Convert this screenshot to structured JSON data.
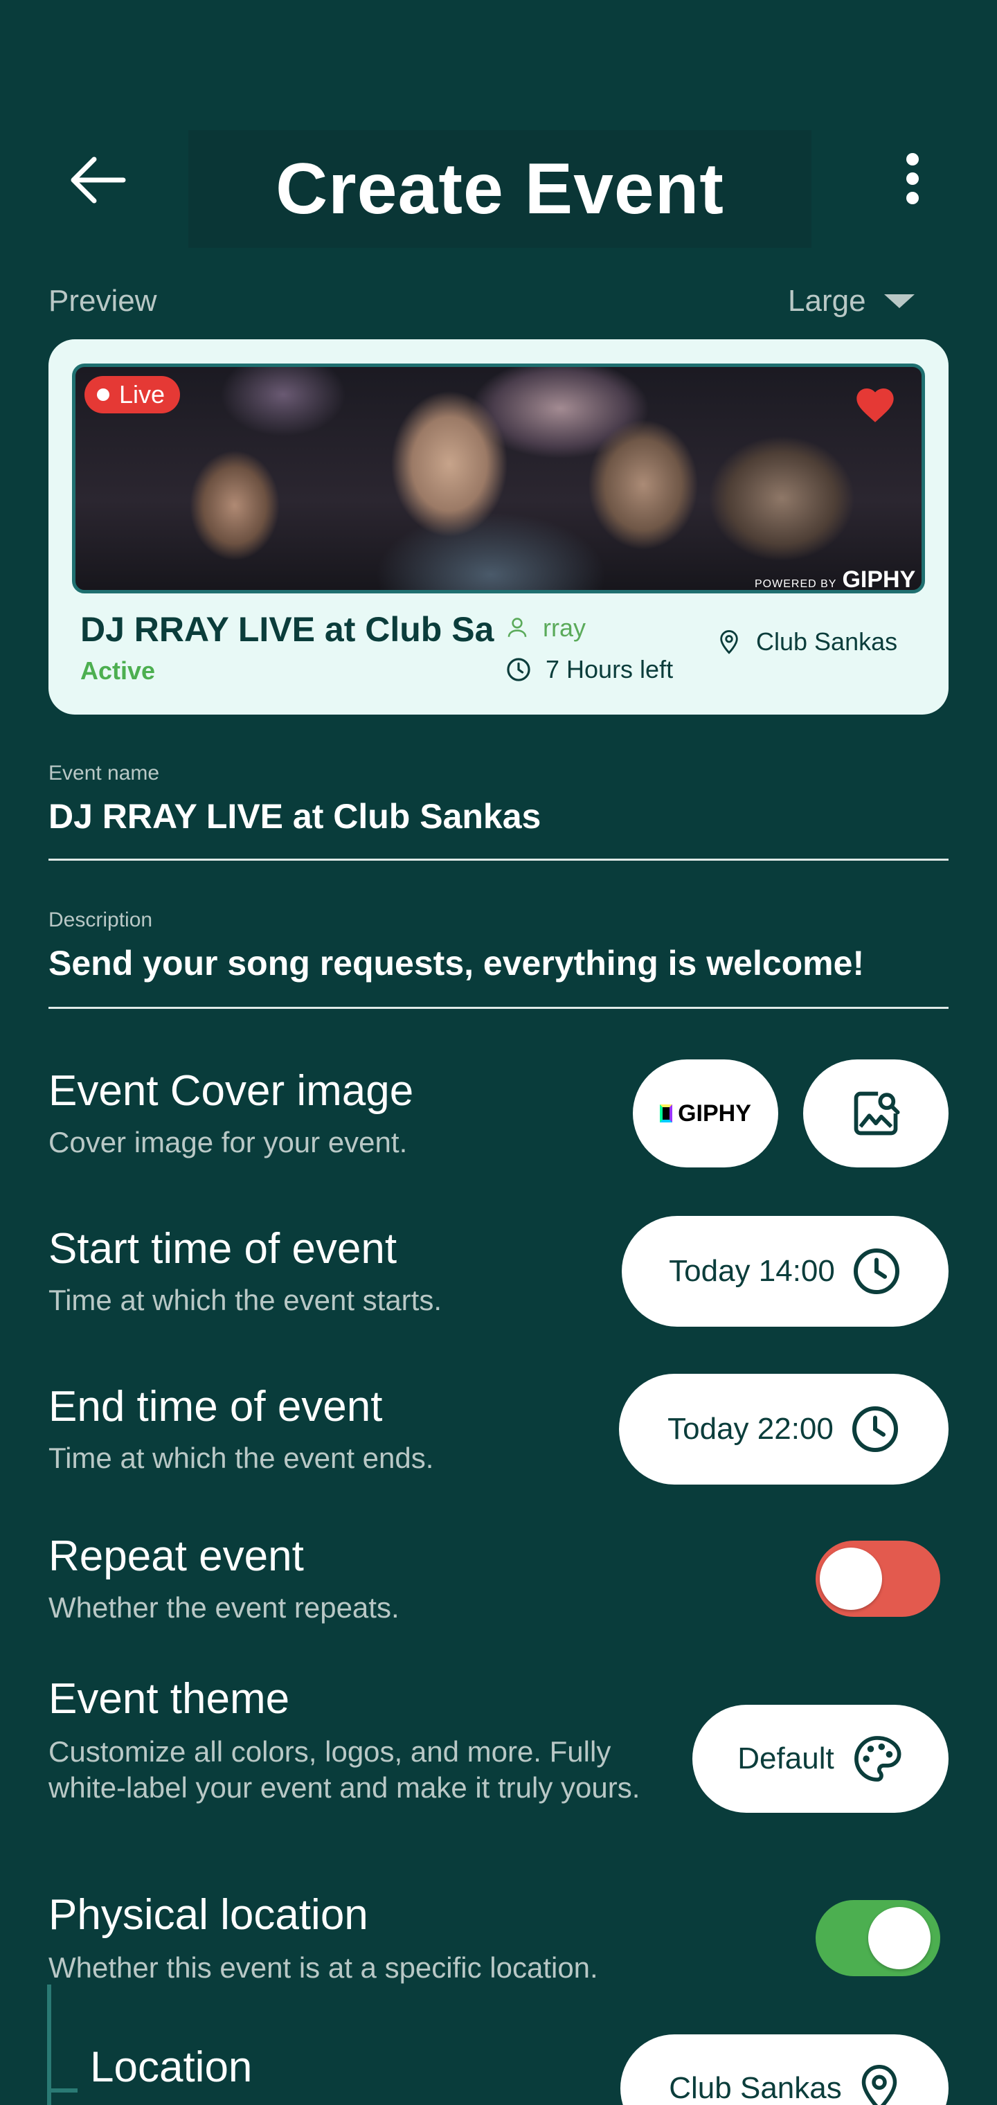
{
  "header": {
    "title": "Create Event"
  },
  "preview": {
    "label": "Preview",
    "size": "Large",
    "card": {
      "live_label": "Live",
      "giphy_powered_small": "POWERED BY",
      "giphy_powered_brand": "GIPHY",
      "event_title": "DJ RRAY LIVE at Club Sankas",
      "status": "Active",
      "host": "rray",
      "time_left": "7 Hours left",
      "location": "Club Sankas"
    }
  },
  "fields": {
    "event_name": {
      "label": "Event name",
      "value": "DJ RRAY LIVE at Club Sankas"
    },
    "description": {
      "label": "Description",
      "value": "Send your song requests, everything is welcome!"
    }
  },
  "settings": {
    "cover_image": {
      "title": "Event Cover image",
      "subtitle": "Cover image for your event.",
      "giphy_label": "GIPHY"
    },
    "start_time": {
      "title": "Start time of event",
      "subtitle": "Time at which the event starts.",
      "value": "Today 14:00"
    },
    "end_time": {
      "title": "End time of event",
      "subtitle": "Time at which the event ends.",
      "value": "Today 22:00"
    },
    "repeat": {
      "title": "Repeat event",
      "subtitle": "Whether the event repeats.",
      "enabled": false
    },
    "theme": {
      "title": "Event theme",
      "subtitle": "Customize all colors, logos, and more. Fully white-label your event and make it truly yours.",
      "value": "Default"
    },
    "physical_location": {
      "title": "Physical location",
      "subtitle": "Whether this event is at a specific location.",
      "enabled": true
    },
    "location": {
      "title": "Location",
      "value": "Club Sankas"
    }
  },
  "colors": {
    "background": "#093c3b",
    "card": "#e8f9f6",
    "accent_green": "#4caf50",
    "toggle_off": "#e35a4e",
    "toggle_on": "#4caf50",
    "live_red": "#e53935"
  }
}
